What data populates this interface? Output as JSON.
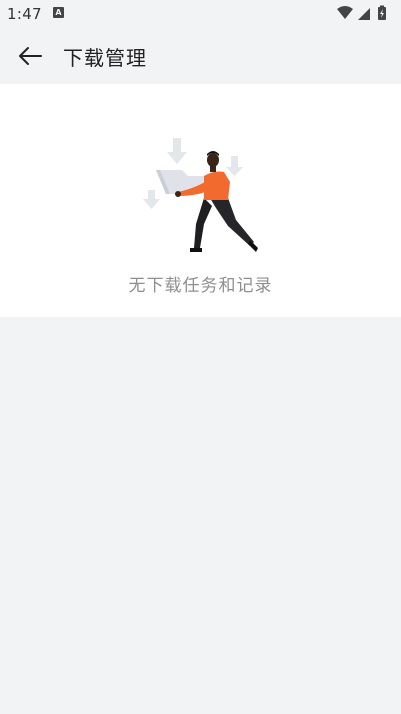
{
  "status_bar": {
    "time": "1:47",
    "notification_badge": "A",
    "icons": [
      "wifi-icon",
      "cellular-signal-icon",
      "battery-charging-icon"
    ]
  },
  "app_bar": {
    "back_icon": "arrow-left-icon",
    "title": "下载管理"
  },
  "empty_state": {
    "illustration": "person-carrying-download-folder",
    "message": "无下载任务和记录"
  },
  "colors": {
    "page_background": "#f2f3f5",
    "panel_background": "#ffffff",
    "accent_orange": "#f26a2e",
    "arrow_gray": "#e3e6eb",
    "empty_text": "#8f8f8f"
  }
}
